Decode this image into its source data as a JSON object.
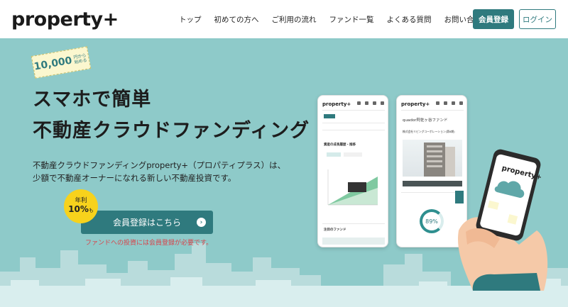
{
  "header": {
    "logo": "property+",
    "nav": [
      "トップ",
      "初めての方へ",
      "ご利用の流れ",
      "ファンド一覧",
      "よくある質問",
      "お問い合わせ"
    ],
    "register_button": "会員登録",
    "login_button": "ログイン"
  },
  "hero": {
    "stamp_amount": "10,000",
    "stamp_suffix": "円から始める",
    "title_line1": "スマホで簡単",
    "title_line2": "不動産クラウドファンディング",
    "description_line1": "不動産クラウドファンディングproperty+（プロパティプラス）は、",
    "description_line2": "少額で不動産オーナーになれる新しい不動産投資です。",
    "badge_line1": "年利",
    "badge_value": "10%",
    "badge_suffix": "も",
    "cta_label": "会員登録はこちら",
    "note": "ファンドへの投資には会員登録が必要です。"
  },
  "phone1": {
    "logo": "property+",
    "section_title": "資産の成長履歴・推移",
    "bottom_title": "注目のファンド"
  },
  "phone2": {
    "logo": "property+",
    "fund_title": "quador阿佐ヶ谷ファンド",
    "company": "株式会社リビングコーポレーション(第8期)",
    "progress": "89%"
  },
  "hand_phone": {
    "logo": "property+"
  },
  "colors": {
    "brand": "#2f7a7e",
    "hero_bg": "#8ecac9",
    "badge": "#f7d21c",
    "note": "#d8434a"
  }
}
